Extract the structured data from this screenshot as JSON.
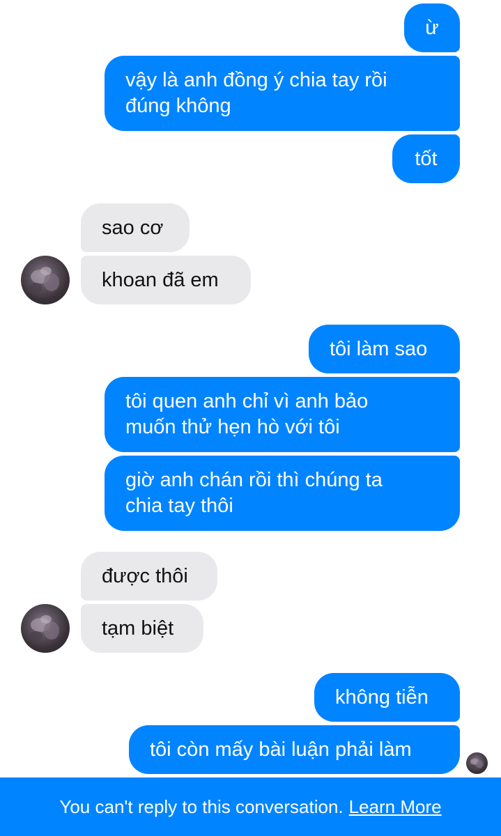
{
  "conversation": {
    "messages": [
      {
        "text": "ừ",
        "direction": "sent"
      },
      {
        "text": "vậy là anh đồng ý chia tay rồi\nđúng không",
        "direction": "sent"
      },
      {
        "text": "tốt",
        "direction": "sent"
      },
      {
        "text": "sao cơ",
        "direction": "received"
      },
      {
        "text": "khoan đã em",
        "direction": "received"
      },
      {
        "text": "tôi làm sao",
        "direction": "sent"
      },
      {
        "text": "tôi quen anh chỉ vì anh bảo\nmuốn thử hẹn hò với tôi",
        "direction": "sent"
      },
      {
        "text": "giờ anh chán rồi thì chúng ta\nchia tay thôi",
        "direction": "sent"
      },
      {
        "text": "được thôi",
        "direction": "received"
      },
      {
        "text": "tạm biệt",
        "direction": "received"
      },
      {
        "text": "không tiễn",
        "direction": "sent"
      },
      {
        "text": "tôi còn mấy bài luận phải làm",
        "direction": "sent"
      }
    ]
  },
  "footer": {
    "notice": "You can't reply to this conversation.",
    "link_label": "Learn More"
  },
  "colors": {
    "sent_bubble": "#0084ff",
    "received_bubble": "#e9e9eb",
    "footer_bar": "#0084ff"
  }
}
